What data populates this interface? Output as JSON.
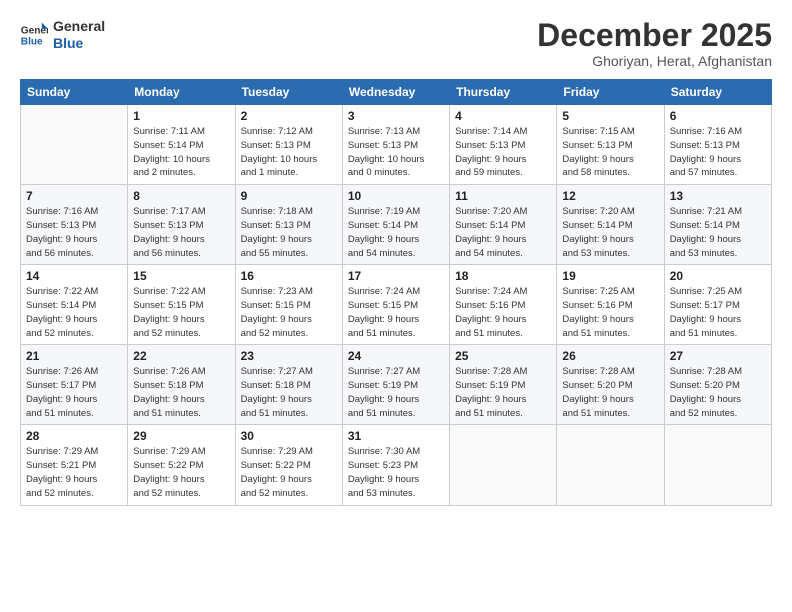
{
  "header": {
    "logo_line1": "General",
    "logo_line2": "Blue",
    "month": "December 2025",
    "location": "Ghoriyan, Herat, Afghanistan"
  },
  "weekdays": [
    "Sunday",
    "Monday",
    "Tuesday",
    "Wednesday",
    "Thursday",
    "Friday",
    "Saturday"
  ],
  "weeks": [
    [
      {
        "day": "",
        "info": ""
      },
      {
        "day": "1",
        "info": "Sunrise: 7:11 AM\nSunset: 5:14 PM\nDaylight: 10 hours\nand 2 minutes."
      },
      {
        "day": "2",
        "info": "Sunrise: 7:12 AM\nSunset: 5:13 PM\nDaylight: 10 hours\nand 1 minute."
      },
      {
        "day": "3",
        "info": "Sunrise: 7:13 AM\nSunset: 5:13 PM\nDaylight: 10 hours\nand 0 minutes."
      },
      {
        "day": "4",
        "info": "Sunrise: 7:14 AM\nSunset: 5:13 PM\nDaylight: 9 hours\nand 59 minutes."
      },
      {
        "day": "5",
        "info": "Sunrise: 7:15 AM\nSunset: 5:13 PM\nDaylight: 9 hours\nand 58 minutes."
      },
      {
        "day": "6",
        "info": "Sunrise: 7:16 AM\nSunset: 5:13 PM\nDaylight: 9 hours\nand 57 minutes."
      }
    ],
    [
      {
        "day": "7",
        "info": "Sunrise: 7:16 AM\nSunset: 5:13 PM\nDaylight: 9 hours\nand 56 minutes."
      },
      {
        "day": "8",
        "info": "Sunrise: 7:17 AM\nSunset: 5:13 PM\nDaylight: 9 hours\nand 56 minutes."
      },
      {
        "day": "9",
        "info": "Sunrise: 7:18 AM\nSunset: 5:13 PM\nDaylight: 9 hours\nand 55 minutes."
      },
      {
        "day": "10",
        "info": "Sunrise: 7:19 AM\nSunset: 5:14 PM\nDaylight: 9 hours\nand 54 minutes."
      },
      {
        "day": "11",
        "info": "Sunrise: 7:20 AM\nSunset: 5:14 PM\nDaylight: 9 hours\nand 54 minutes."
      },
      {
        "day": "12",
        "info": "Sunrise: 7:20 AM\nSunset: 5:14 PM\nDaylight: 9 hours\nand 53 minutes."
      },
      {
        "day": "13",
        "info": "Sunrise: 7:21 AM\nSunset: 5:14 PM\nDaylight: 9 hours\nand 53 minutes."
      }
    ],
    [
      {
        "day": "14",
        "info": "Sunrise: 7:22 AM\nSunset: 5:14 PM\nDaylight: 9 hours\nand 52 minutes."
      },
      {
        "day": "15",
        "info": "Sunrise: 7:22 AM\nSunset: 5:15 PM\nDaylight: 9 hours\nand 52 minutes."
      },
      {
        "day": "16",
        "info": "Sunrise: 7:23 AM\nSunset: 5:15 PM\nDaylight: 9 hours\nand 52 minutes."
      },
      {
        "day": "17",
        "info": "Sunrise: 7:24 AM\nSunset: 5:15 PM\nDaylight: 9 hours\nand 51 minutes."
      },
      {
        "day": "18",
        "info": "Sunrise: 7:24 AM\nSunset: 5:16 PM\nDaylight: 9 hours\nand 51 minutes."
      },
      {
        "day": "19",
        "info": "Sunrise: 7:25 AM\nSunset: 5:16 PM\nDaylight: 9 hours\nand 51 minutes."
      },
      {
        "day": "20",
        "info": "Sunrise: 7:25 AM\nSunset: 5:17 PM\nDaylight: 9 hours\nand 51 minutes."
      }
    ],
    [
      {
        "day": "21",
        "info": "Sunrise: 7:26 AM\nSunset: 5:17 PM\nDaylight: 9 hours\nand 51 minutes."
      },
      {
        "day": "22",
        "info": "Sunrise: 7:26 AM\nSunset: 5:18 PM\nDaylight: 9 hours\nand 51 minutes."
      },
      {
        "day": "23",
        "info": "Sunrise: 7:27 AM\nSunset: 5:18 PM\nDaylight: 9 hours\nand 51 minutes."
      },
      {
        "day": "24",
        "info": "Sunrise: 7:27 AM\nSunset: 5:19 PM\nDaylight: 9 hours\nand 51 minutes."
      },
      {
        "day": "25",
        "info": "Sunrise: 7:28 AM\nSunset: 5:19 PM\nDaylight: 9 hours\nand 51 minutes."
      },
      {
        "day": "26",
        "info": "Sunrise: 7:28 AM\nSunset: 5:20 PM\nDaylight: 9 hours\nand 51 minutes."
      },
      {
        "day": "27",
        "info": "Sunrise: 7:28 AM\nSunset: 5:20 PM\nDaylight: 9 hours\nand 52 minutes."
      }
    ],
    [
      {
        "day": "28",
        "info": "Sunrise: 7:29 AM\nSunset: 5:21 PM\nDaylight: 9 hours\nand 52 minutes."
      },
      {
        "day": "29",
        "info": "Sunrise: 7:29 AM\nSunset: 5:22 PM\nDaylight: 9 hours\nand 52 minutes."
      },
      {
        "day": "30",
        "info": "Sunrise: 7:29 AM\nSunset: 5:22 PM\nDaylight: 9 hours\nand 52 minutes."
      },
      {
        "day": "31",
        "info": "Sunrise: 7:30 AM\nSunset: 5:23 PM\nDaylight: 9 hours\nand 53 minutes."
      },
      {
        "day": "",
        "info": ""
      },
      {
        "day": "",
        "info": ""
      },
      {
        "day": "",
        "info": ""
      }
    ]
  ]
}
